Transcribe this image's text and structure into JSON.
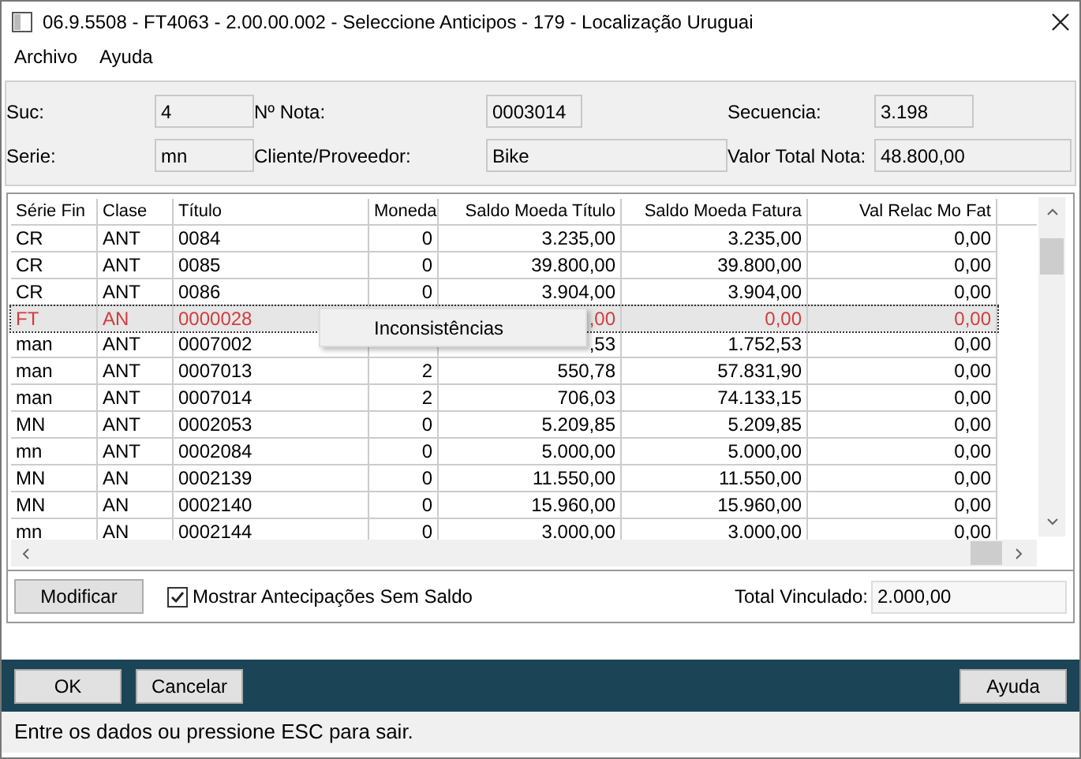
{
  "window": {
    "title": "06.9.5508 - FT4063 - 2.00.00.002 - Seleccione Anticipos - 179 - Localização Uruguai"
  },
  "menu": [
    "Archivo",
    "Ayuda"
  ],
  "header_fields": [
    {
      "label": "Suc:",
      "value": "4"
    },
    {
      "label": "Nº Nota:",
      "value": "0003014"
    },
    {
      "label": "Secuencia:",
      "value": "3.198"
    },
    {
      "label": "Serie:",
      "value": "mn"
    },
    {
      "label": "Cliente/Proveedor:",
      "value": "Bike"
    },
    {
      "label": "Valor Total Nota:",
      "value": "48.800,00"
    }
  ],
  "table": {
    "columns": [
      "Série Fin",
      "Clase",
      "Título",
      "Moneda",
      "Saldo Moeda Título",
      "Saldo Moeda Fatura",
      "Val Relac Mo Fat"
    ],
    "rows": [
      {
        "cells": [
          "CR",
          "ANT",
          "0084",
          "0",
          "3.235,00",
          "3.235,00",
          "0,00"
        ],
        "selected": false,
        "error": false
      },
      {
        "cells": [
          "CR",
          "ANT",
          "0085",
          "0",
          "39.800,00",
          "39.800,00",
          "0,00"
        ],
        "selected": false,
        "error": false
      },
      {
        "cells": [
          "CR",
          "ANT",
          "0086",
          "0",
          "3.904,00",
          "3.904,00",
          "0,00"
        ],
        "selected": false,
        "error": false
      },
      {
        "cells": [
          "FT",
          "AN",
          "0000028",
          null,
          ",00",
          "0,00",
          "0,00"
        ],
        "selected": true,
        "error": true
      },
      {
        "cells": [
          "man",
          "ANT",
          "0007002",
          null,
          ",53",
          "1.752,53",
          "0,00"
        ],
        "selected": false,
        "error": false
      },
      {
        "cells": [
          "man",
          "ANT",
          "0007013",
          "2",
          "550,78",
          "57.831,90",
          "0,00"
        ],
        "selected": false,
        "error": false
      },
      {
        "cells": [
          "man",
          "ANT",
          "0007014",
          "2",
          "706,03",
          "74.133,15",
          "0,00"
        ],
        "selected": false,
        "error": false
      },
      {
        "cells": [
          "MN",
          "ANT",
          "0002053",
          "0",
          "5.209,85",
          "5.209,85",
          "0,00"
        ],
        "selected": false,
        "error": false
      },
      {
        "cells": [
          "mn",
          "ANT",
          "0002084",
          "0",
          "5.000,00",
          "5.000,00",
          "0,00"
        ],
        "selected": false,
        "error": false
      },
      {
        "cells": [
          "MN",
          "AN",
          "0002139",
          "0",
          "11.550,00",
          "11.550,00",
          "0,00"
        ],
        "selected": false,
        "error": false
      },
      {
        "cells": [
          "MN",
          "AN",
          "0002140",
          "0",
          "15.960,00",
          "15.960,00",
          "0,00"
        ],
        "selected": false,
        "error": false
      },
      {
        "cells": [
          "mn",
          "AN",
          "0002144",
          "0",
          "3.000,00",
          "3.000,00",
          "0,00"
        ],
        "selected": false,
        "error": false
      }
    ]
  },
  "context_menu": {
    "items": [
      "Inconsistências"
    ]
  },
  "modify_button": "Modificar",
  "show_without_balance": {
    "label": "Mostrar Antecipações Sem Saldo",
    "checked": true
  },
  "total_linked": {
    "label": "Total Vinculado:",
    "value": "2.000,00"
  },
  "footer_buttons": {
    "left": [
      "OK",
      "Cancelar"
    ],
    "right": [
      "Ayuda"
    ]
  },
  "status_bar": "Entre os dados ou pressione ESC para sair."
}
